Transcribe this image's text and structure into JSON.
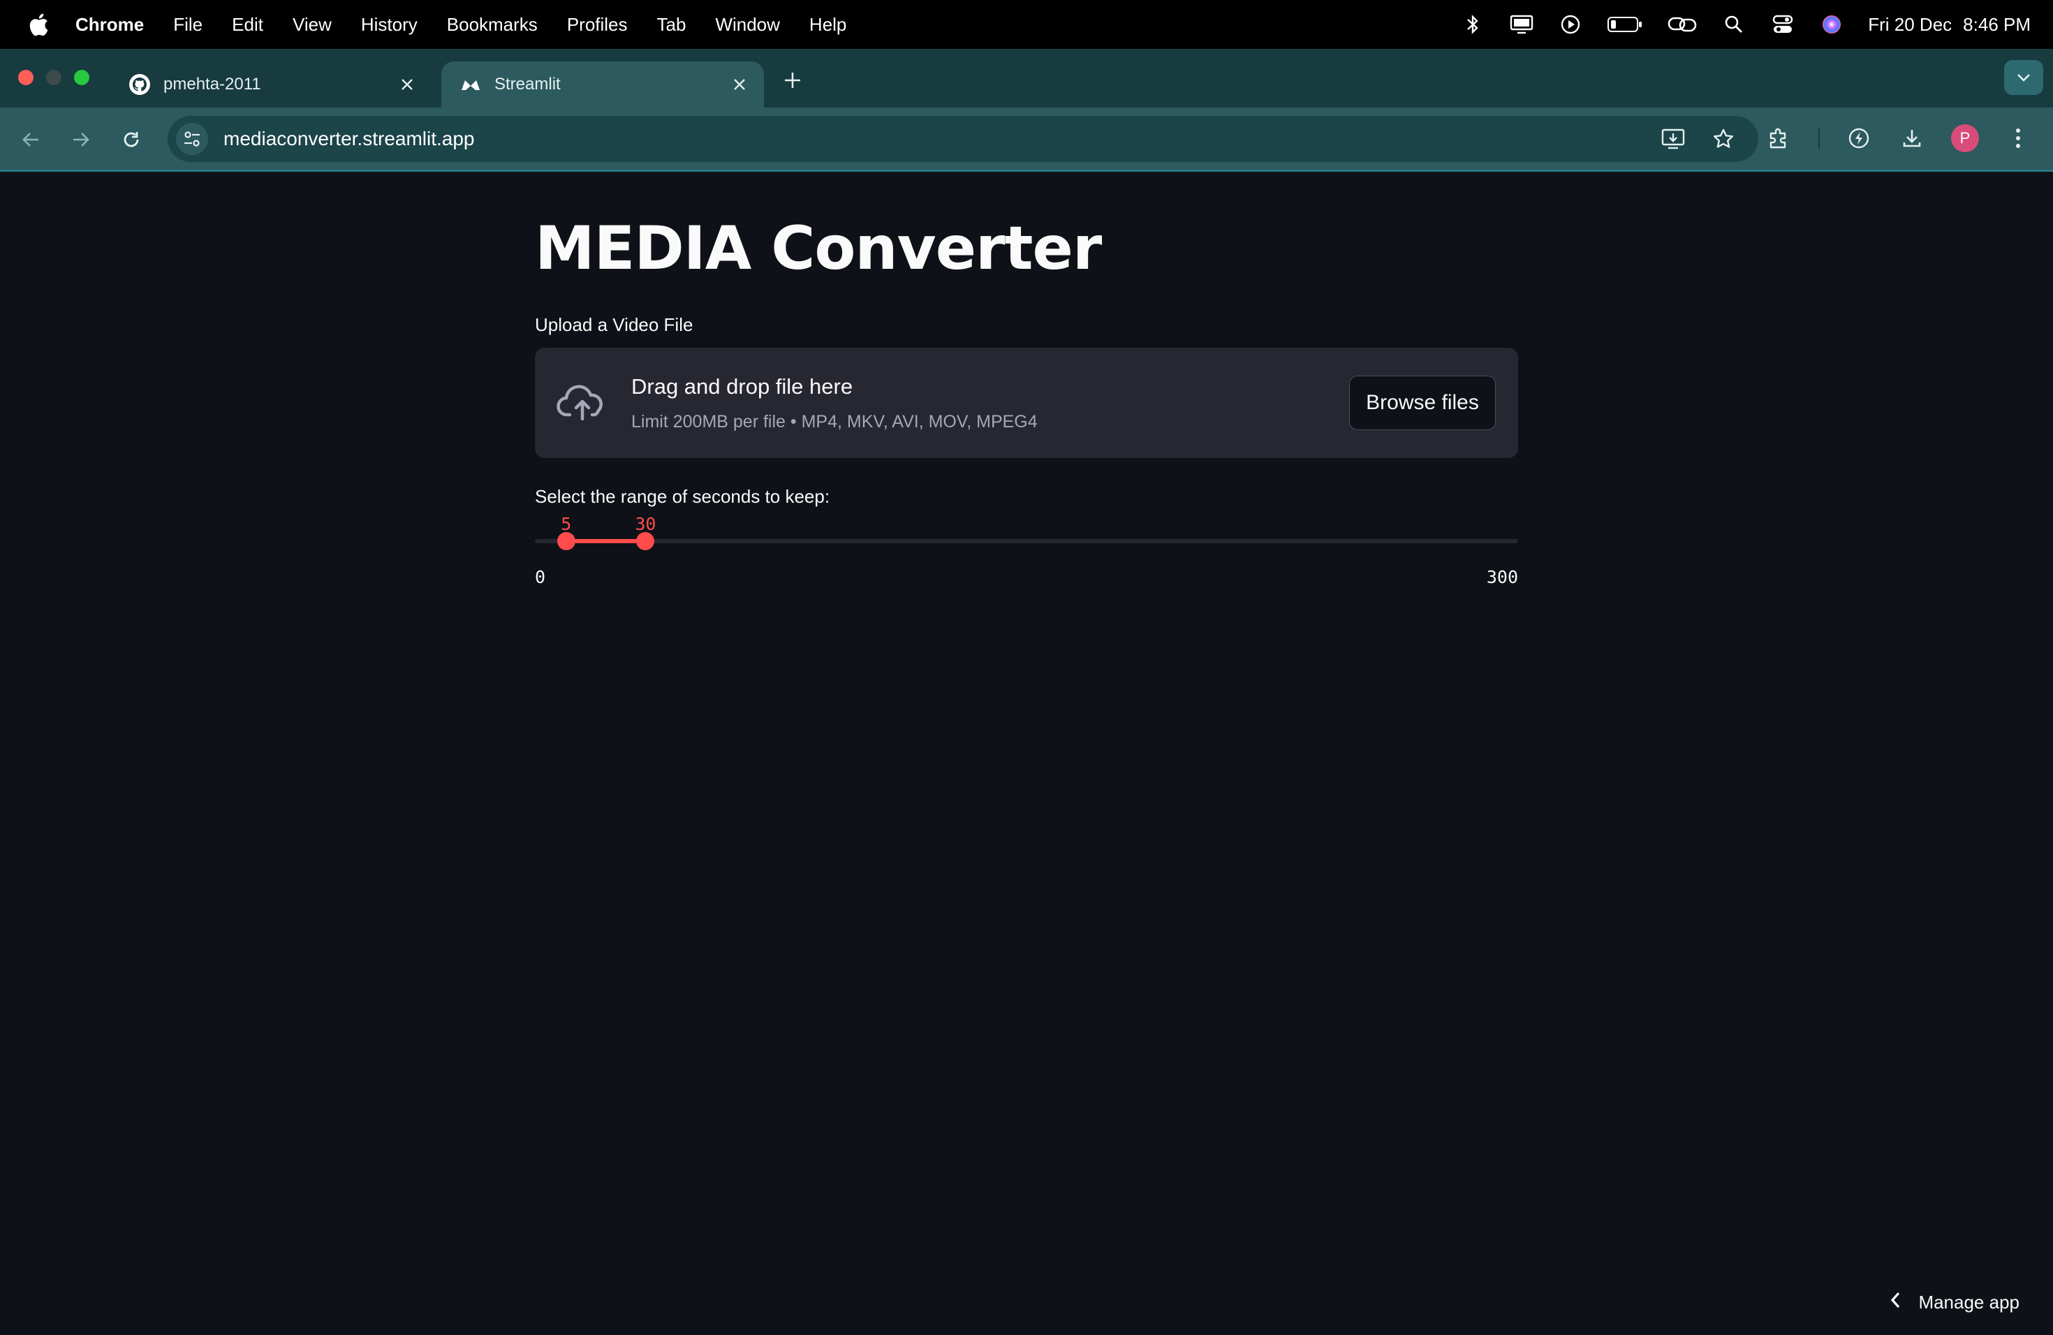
{
  "menubar": {
    "app": "Chrome",
    "items": [
      "File",
      "Edit",
      "View",
      "History",
      "Bookmarks",
      "Profiles",
      "Tab",
      "Window",
      "Help"
    ],
    "clock_date": "Fri 20 Dec",
    "clock_time": "8:46 PM",
    "status_icons": [
      "bluetooth-icon",
      "display-icon",
      "play-icon",
      "battery-icon",
      "link-icon",
      "search-icon",
      "control-center-icon",
      "siri-icon"
    ]
  },
  "tabs": [
    {
      "title": "pmehta-2011",
      "icon": "github-icon",
      "active": false
    },
    {
      "title": "Streamlit",
      "icon": "streamlit-icon",
      "active": true
    }
  ],
  "toolbar": {
    "url": "mediaconverter.streamlit.app"
  },
  "page": {
    "title": "MEDIA Converter",
    "upload": {
      "label": "Upload a Video File",
      "drop_text": "Drag and drop file here",
      "limit_text": "Limit 200MB per file • MP4, MKV, AVI, MOV, MPEG4",
      "button": "Browse files"
    },
    "slider": {
      "label": "Select the range of seconds to keep:",
      "min": 0,
      "max": 300,
      "min_label": "0",
      "max_label": "300",
      "low": 5,
      "high": 30,
      "low_label": "5",
      "high_label": "30",
      "accent": "#ff4b4b"
    },
    "manage_app": "Manage app"
  },
  "colors": {
    "background": "#0e1117",
    "tabstrip": "#173b3f",
    "toolbar": "#2c5a5e",
    "accent": "#ff4b4b"
  }
}
